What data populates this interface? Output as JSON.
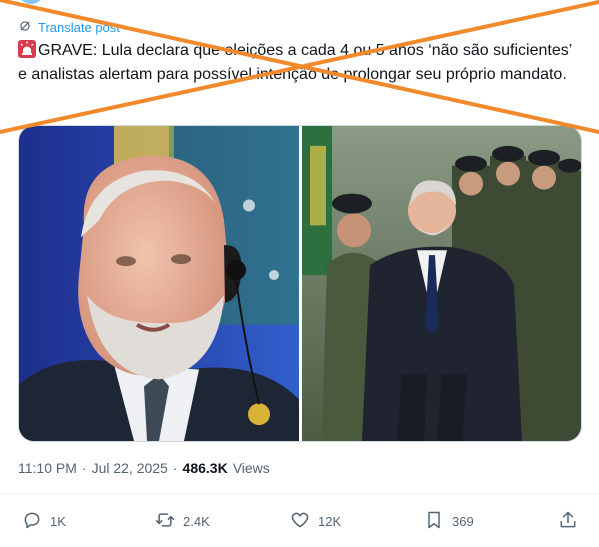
{
  "post": {
    "translate_label": "Translate post",
    "text_flag": "GRAVE:",
    "text_body": "Lula declara que eleições a cada 4 ou 5 anos ‘não são suficientes’ e analistas alertam para possível intenção de prolongar seu próprio mandato.",
    "icons": {
      "translate": "translate-icon",
      "siren": "siren-emoji-icon"
    }
  },
  "media": {
    "left_image": "photo-lula-closeup-with-earpiece-brazil-flag",
    "right_image": "photo-lula-walking-past-soldiers"
  },
  "meta": {
    "time": "11:10 PM",
    "separator": "·",
    "date": "Jul 22, 2025",
    "views_count": "486.3K",
    "views_label": "Views"
  },
  "actions": {
    "replies": "1K",
    "reposts": "2.4K",
    "likes": "12K",
    "bookmarks": "369",
    "icons": [
      "reply-icon",
      "repost-icon",
      "like-icon",
      "bookmark-icon",
      "share-icon"
    ]
  },
  "colors": {
    "accent": "#1d9bf0",
    "secondary_text": "#536471",
    "primary_text": "#0f1419",
    "overlay_cross": "#f08a2c"
  }
}
